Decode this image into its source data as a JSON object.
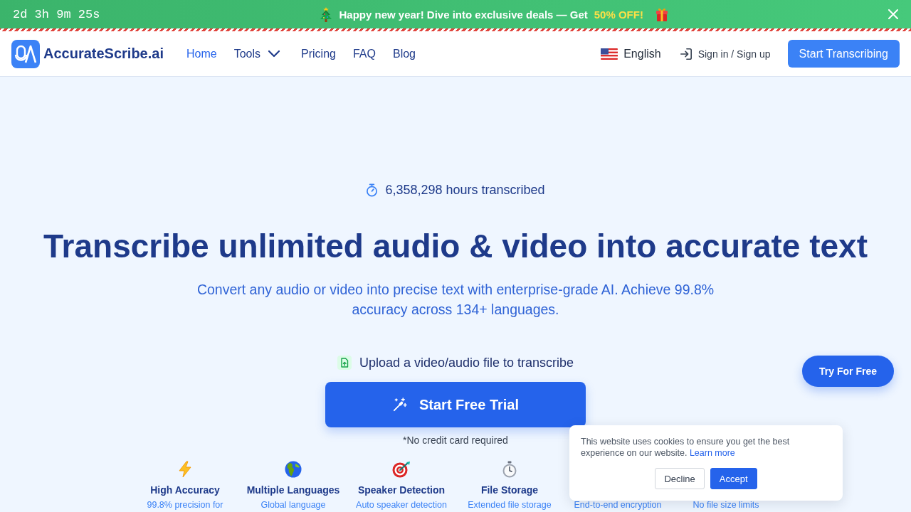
{
  "promo_banner": {
    "countdown": "2d 3h 9m 25s",
    "message": "Happy new year! Dive into exclusive deals — Get",
    "highlight": "50% OFF!"
  },
  "header": {
    "brand": "AccurateScribe.ai",
    "nav": [
      {
        "label": "Home",
        "selected": true,
        "dropdown": false
      },
      {
        "label": "Tools",
        "selected": false,
        "dropdown": true
      },
      {
        "label": "Pricing",
        "selected": false,
        "dropdown": false
      },
      {
        "label": "FAQ",
        "selected": false,
        "dropdown": false
      },
      {
        "label": "Blog",
        "selected": false,
        "dropdown": false
      }
    ],
    "language": "English",
    "sign_in": "Sign in / Sign up",
    "cta": "Start Transcribing"
  },
  "hero": {
    "stat": "6,358,298 hours transcribed",
    "title": "Transcribe unlimited audio & video into accurate text",
    "subtitle": "Convert any audio or video into precise text with enterprise-grade AI. Achieve 99.8% accuracy across 134+ languages.",
    "upload_prompt": "Upload a video/audio file to transcribe",
    "button": "Start Free Trial",
    "note": "*No credit card required"
  },
  "features": [
    {
      "title": "High Accuracy",
      "description": "99.8% precision for"
    },
    {
      "title": "Multiple Languages",
      "description": "Global language"
    },
    {
      "title": "Speaker Detection",
      "description": "Auto speaker detection"
    },
    {
      "title": "File Storage",
      "description": "Extended file storage"
    },
    {
      "description": "End-to-end encryption"
    },
    {
      "description": "No file size limits"
    }
  ],
  "floating_button": "Try For Free",
  "cookie_notice": {
    "text": "This website uses cookies to ensure you get the best experience on our website.",
    "link": "Learn more",
    "buttons": [
      {
        "label": "Decline",
        "kind": "secondary"
      },
      {
        "label": "Accept",
        "kind": "primary"
      }
    ]
  }
}
